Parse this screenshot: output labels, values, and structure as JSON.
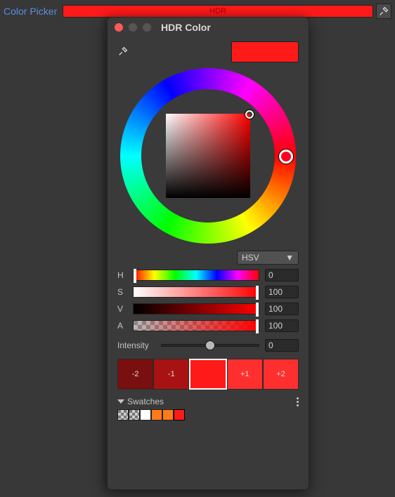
{
  "top": {
    "label": "Color Picker",
    "field_text": "HDR"
  },
  "panel": {
    "title": "HDR Color"
  },
  "current_color": "#ff1a1a",
  "mode": {
    "selected": "HSV"
  },
  "channels": {
    "H": {
      "label": "H",
      "value": "0"
    },
    "S": {
      "label": "S",
      "value": "100"
    },
    "V": {
      "label": "V",
      "value": "100"
    },
    "A": {
      "label": "A",
      "value": "100"
    }
  },
  "intensity": {
    "label": "Intensity",
    "value": "0"
  },
  "steps": [
    {
      "label": "-2",
      "color": "#7a0f0f"
    },
    {
      "label": "-1",
      "color": "#a91212"
    },
    {
      "label": "",
      "color": "#ff1a1a",
      "selected": true
    },
    {
      "label": "+1",
      "color": "#ff2f2f"
    },
    {
      "label": "+2",
      "color": "#ff2f2f"
    }
  ],
  "swatches_label": "Swatches",
  "swatches": [
    {
      "type": "checker"
    },
    {
      "type": "checker"
    },
    {
      "type": "solid",
      "color": "#ffffff"
    },
    {
      "type": "solid",
      "color": "#ff7a1a"
    },
    {
      "type": "solid",
      "color": "#ff7a1a"
    },
    {
      "type": "solid",
      "color": "#ff1a1a",
      "outlined": true
    }
  ]
}
